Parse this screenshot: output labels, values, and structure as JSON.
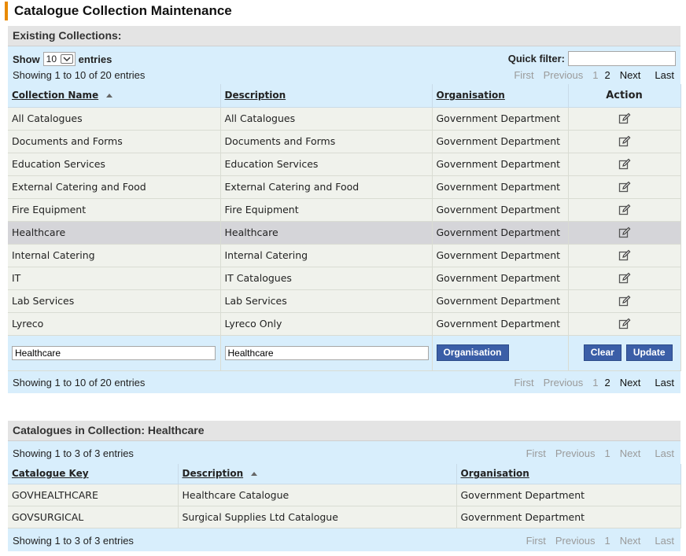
{
  "page": {
    "title": "Catalogue Collection Maintenance"
  },
  "collections": {
    "header": "Existing Collections:",
    "show_label": "Show",
    "entries_label": "entries",
    "page_size": "10",
    "quick_filter_label": "Quick filter:",
    "quick_filter_value": "",
    "info_top": "Showing 1 to 10 of 20 entries",
    "info_bottom": "Showing 1 to 10 of 20 entries",
    "pager": {
      "first": "First",
      "previous": "Previous",
      "page1": "1",
      "page2": "2",
      "next": "Next",
      "last": "Last"
    },
    "columns": {
      "name": "Collection Name",
      "description": "Description",
      "organisation": "Organisation",
      "action": "Action"
    },
    "rows": [
      {
        "name": "All Catalogues",
        "description": "All Catalogues",
        "organisation": "Government Department"
      },
      {
        "name": "Documents and Forms",
        "description": "Documents and Forms",
        "organisation": "Government Department"
      },
      {
        "name": "Education Services",
        "description": "Education Services",
        "organisation": "Government Department"
      },
      {
        "name": "External Catering and Food",
        "description": "External Catering and Food",
        "organisation": "Government Department"
      },
      {
        "name": "Fire Equipment",
        "description": "Fire Equipment",
        "organisation": "Government Department"
      },
      {
        "name": "Healthcare",
        "description": "Healthcare",
        "organisation": "Government Department"
      },
      {
        "name": "Internal Catering",
        "description": "Internal Catering",
        "organisation": "Government Department"
      },
      {
        "name": "IT",
        "description": "IT Catalogues",
        "organisation": "Government Department"
      },
      {
        "name": "Lab Services",
        "description": "Lab Services",
        "organisation": "Government Department"
      },
      {
        "name": "Lyreco",
        "description": "Lyreco Only",
        "organisation": "Government Department"
      }
    ],
    "selected_row": "Healthcare",
    "edit_form": {
      "name_value": "Healthcare",
      "description_value": "Healthcare",
      "organisation_button": "Organisation",
      "clear_button": "Clear",
      "update_button": "Update"
    }
  },
  "catalogues": {
    "header_prefix": "Catalogues in Collection:",
    "header_collection": "Healthcare",
    "info_top": "Showing 1 to 3 of 3 entries",
    "info_bottom": "Showing 1 to 3 of 3 entries",
    "pager": {
      "first": "First",
      "previous": "Previous",
      "page1": "1",
      "next": "Next",
      "last": "Last"
    },
    "columns": {
      "key": "Catalogue Key",
      "description": "Description",
      "organisation": "Organisation"
    },
    "rows": [
      {
        "key": "GOVHEALTHCARE",
        "description": "Healthcare Catalogue",
        "organisation": "Government Department"
      },
      {
        "key": "GOVSURGICAL",
        "description": "Surgical Supplies Ltd Catalogue",
        "organisation": "Government Department"
      }
    ]
  },
  "colors": {
    "accent": "#e88a00",
    "toolbar": "#d8eefc",
    "button": "#3b5ea7",
    "row": "#f0f2ec",
    "selected": "#d5d5d9"
  }
}
